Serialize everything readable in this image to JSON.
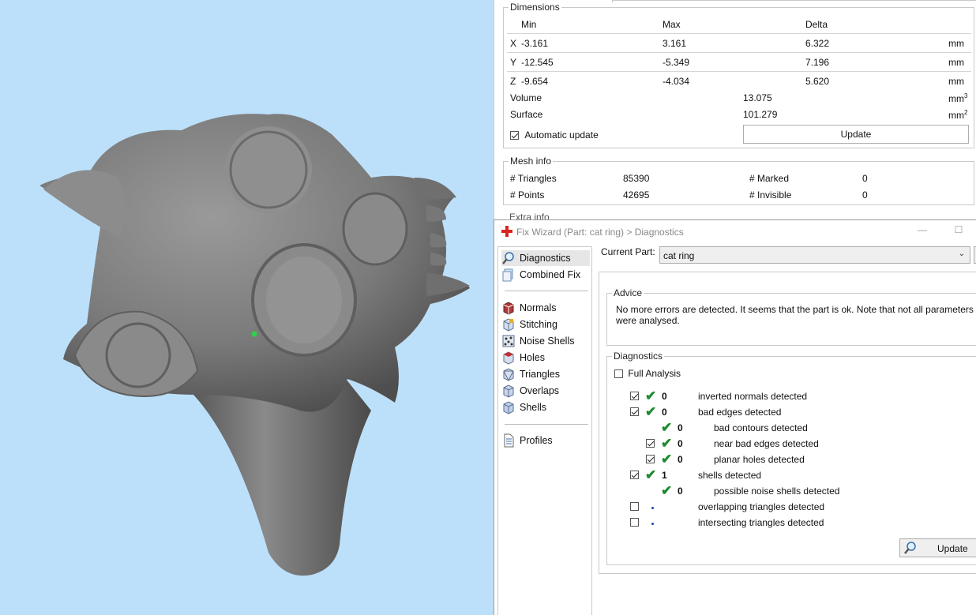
{
  "dimensions": {
    "legend": "Dimensions",
    "headers": {
      "min": "Min",
      "max": "Max",
      "delta": "Delta"
    },
    "rows": [
      {
        "axis": "X",
        "min": "-3.161",
        "max": "3.161",
        "delta": "6.322",
        "unit": "mm"
      },
      {
        "axis": "Y",
        "min": "-12.545",
        "max": "-5.349",
        "delta": "7.196",
        "unit": "mm"
      },
      {
        "axis": "Z",
        "min": "-9.654",
        "max": "-4.034",
        "delta": "5.620",
        "unit": "mm"
      }
    ],
    "volume": {
      "label": "Volume",
      "value": "13.075",
      "unit": "mm",
      "unit_sup": "3"
    },
    "surface": {
      "label": "Surface",
      "value": "101.279",
      "unit": "mm",
      "unit_sup": "2"
    },
    "auto_update": {
      "label": "Automatic update",
      "checked": true
    },
    "update_button": "Update"
  },
  "mesh_info": {
    "legend": "Mesh info",
    "triangles_label": "# Triangles",
    "triangles": "85390",
    "points_label": "# Points",
    "points": "42695",
    "marked_label": "# Marked",
    "marked": "0",
    "invisible_label": "# Invisible",
    "invisible": "0"
  },
  "extra_info": {
    "legend": "Extra info"
  },
  "wizard": {
    "title": "Fix Wizard (Part: cat ring) > Diagnostics",
    "nav": {
      "diagnostics": "Diagnostics",
      "combined_fix": "Combined Fix",
      "normals": "Normals",
      "stitching": "Stitching",
      "noise_shells": "Noise Shells",
      "holes": "Holes",
      "triangles": "Triangles",
      "overlaps": "Overlaps",
      "shells": "Shells",
      "profiles": "Profiles"
    },
    "current_part_label": "Current Part:",
    "current_part": "cat ring",
    "advice": {
      "legend": "Advice",
      "line1": "No more errors are detected. It seems that the part is ok. Note that not all parameters",
      "line2": "were analysed."
    },
    "diagnostics": {
      "legend": "Diagnostics",
      "full_analysis": "Full Analysis",
      "items": [
        {
          "count": "0",
          "label": "inverted normals detected",
          "checked": true,
          "status": "ok"
        },
        {
          "count": "0",
          "label": "bad edges detected",
          "checked": true,
          "status": "ok"
        },
        {
          "count": "0",
          "label": "bad contours detected",
          "status": "ok"
        },
        {
          "count": "0",
          "label": "near bad edges detected",
          "checked": true,
          "status": "ok"
        },
        {
          "count": "0",
          "label": "planar holes detected",
          "checked": true,
          "status": "ok"
        },
        {
          "count": "1",
          "label": "shells detected",
          "checked": true,
          "status": "ok"
        },
        {
          "count": "0",
          "label": "possible noise shells detected",
          "status": "ok"
        },
        {
          "count": "",
          "label": "overlapping triangles detected",
          "checked": false,
          "status": "not-run"
        },
        {
          "count": "",
          "label": "intersecting triangles detected",
          "checked": false,
          "status": "not-run"
        }
      ],
      "update_button": "Update"
    }
  },
  "colors": {
    "viewport_bg": "#bde0fa",
    "ok_check": "#1e8a2e",
    "not_run_dot": "#1c3fb8"
  }
}
